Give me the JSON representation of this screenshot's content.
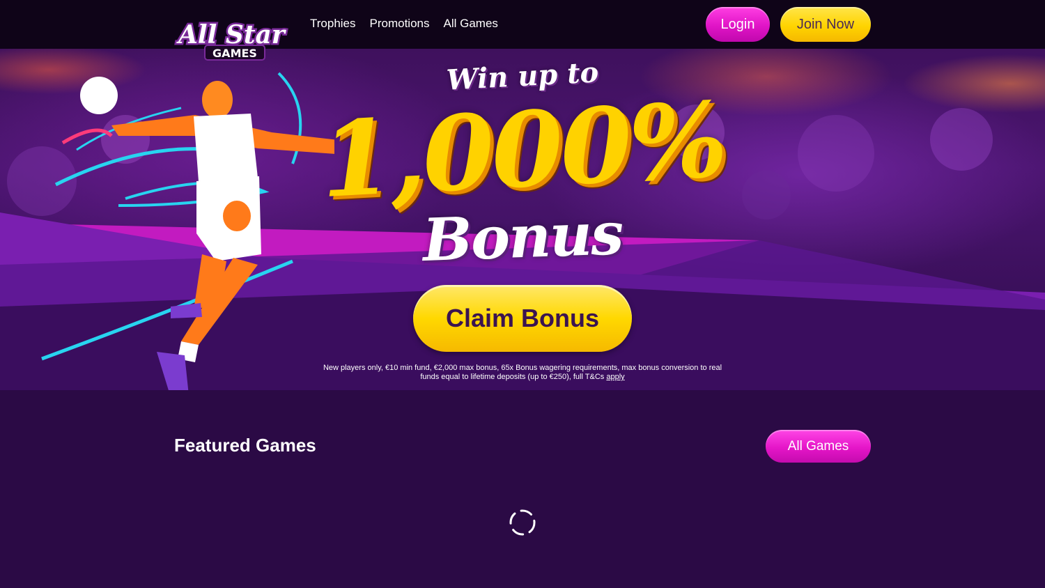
{
  "brand": {
    "logo_line1": "All Star",
    "logo_line2": "GAMES",
    "colors": {
      "pink": "#e014c6",
      "yellow": "#ffd400",
      "purple_bg": "#2b0a45",
      "nav_bg": "#0f0418"
    }
  },
  "nav": {
    "links": [
      "Trophies",
      "Promotions",
      "All Games"
    ],
    "login_label": "Login",
    "join_label": "Join Now"
  },
  "hero": {
    "headline_small": "Win up to",
    "headline_big": "1,000%",
    "headline_bonus": "Bonus",
    "cta_label": "Claim Bonus",
    "terms_text": "New players only, €10 min fund, €2,000 max bonus, 65x Bonus wagering requirements, max bonus conversion to real funds equal to lifetime deposits (up to €250), full T&Cs",
    "terms_link": "apply"
  },
  "featured": {
    "title": "Featured Games",
    "all_games_label": "All Games",
    "loading_icon": "spinner-icon"
  }
}
